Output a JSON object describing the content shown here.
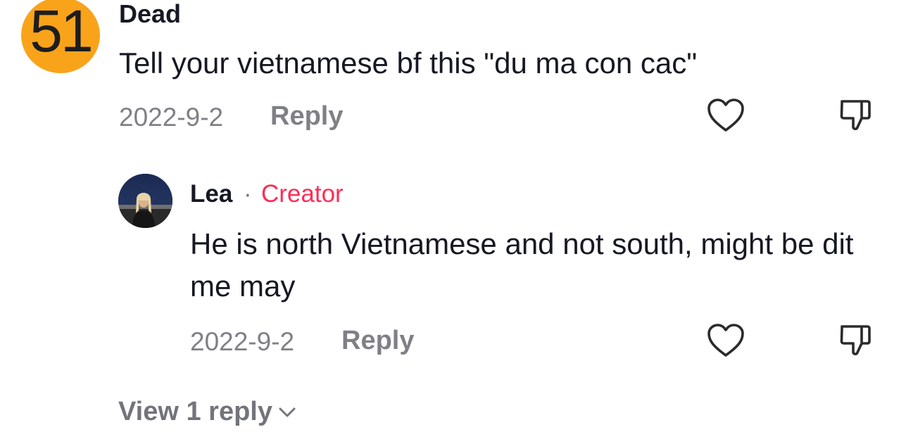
{
  "comment": {
    "avatar_text": "51",
    "avatar_color": "#f9a31a",
    "username": "Dead",
    "text": "Tell your vietnamese bf this \"du ma con cac\"",
    "date": "2022-9-2",
    "reply_label": "Reply",
    "like_icon": "heart-outline-icon",
    "dislike_icon": "thumbs-down-outline-icon"
  },
  "reply": {
    "username": "Lea",
    "separator": "·",
    "badge": "Creator",
    "badge_color": "#fe2c55",
    "text": "He is north Vietnamese and not south, might be dit me may",
    "date": "2022-9-2",
    "reply_label": "Reply",
    "like_icon": "heart-outline-icon",
    "dislike_icon": "thumbs-down-outline-icon"
  },
  "view_replies": {
    "label": "View 1 reply",
    "icon": "chevron-down-icon"
  }
}
